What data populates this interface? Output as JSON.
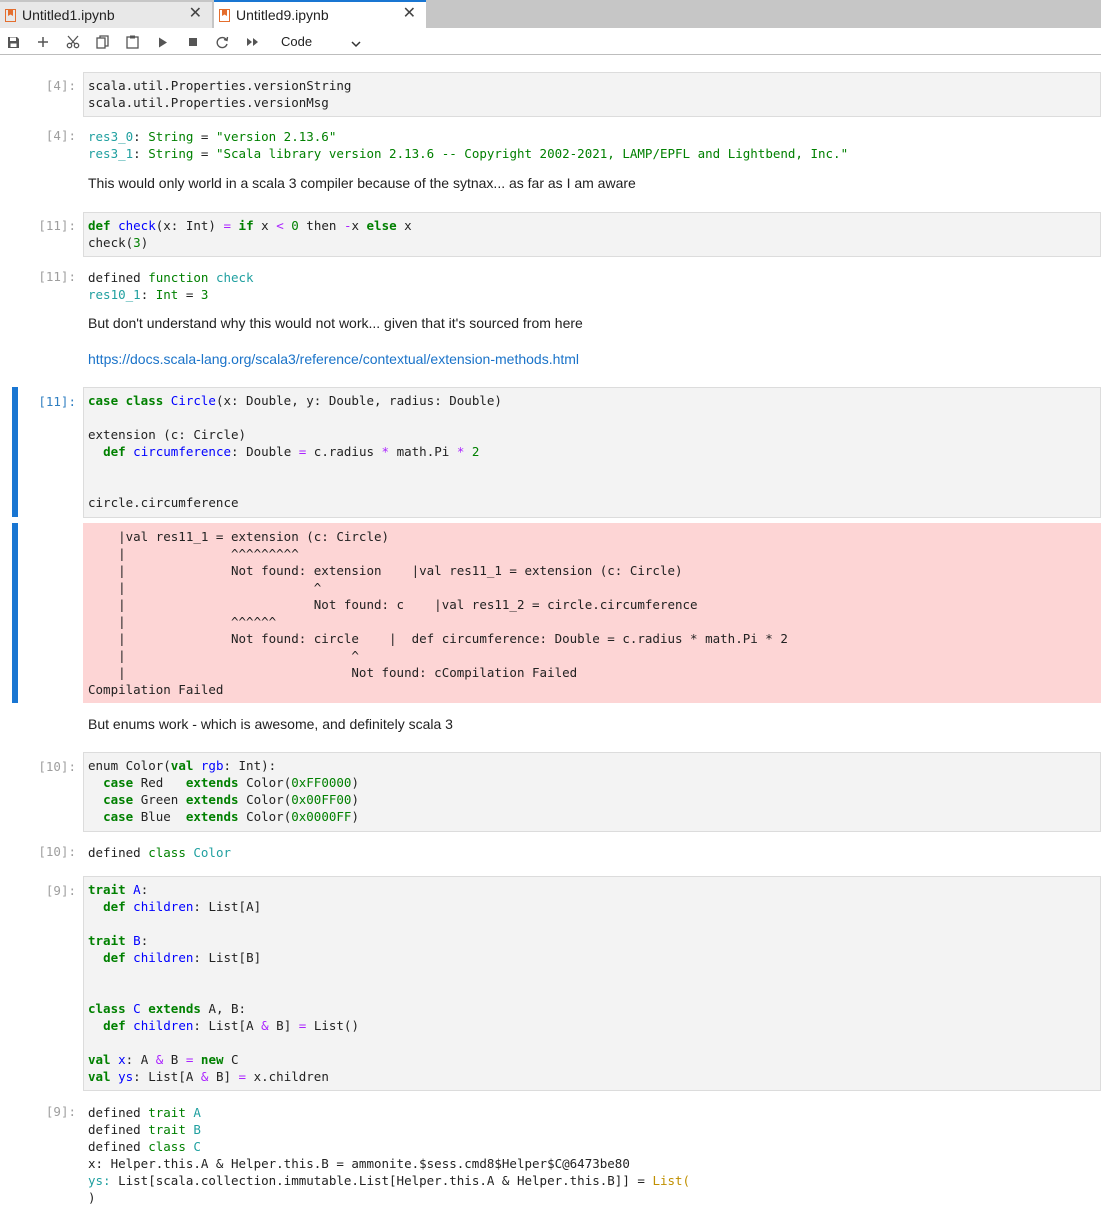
{
  "tabs": [
    {
      "label": "Untitled1.ipynb",
      "active": false
    },
    {
      "label": "Untitled9.ipynb",
      "active": true
    }
  ],
  "toolbar": {
    "cell_type": "Code",
    "icons": [
      "save-icon",
      "add-icon",
      "cut-icon",
      "copy-icon",
      "paste-icon",
      "run-icon",
      "stop-icon",
      "restart-icon",
      "fast-forward-icon",
      "chevron-down-icon"
    ]
  },
  "cells": {
    "c1": {
      "in_prompt": "[4]:",
      "code": [
        "scala.util.Properties.versionString",
        "scala.util.Properties.versionMsg"
      ],
      "out_prompt": "[4]:",
      "out": {
        "r1_name": "res3_0",
        "r1_type": "String",
        "r1_val": "\"version 2.13.6\"",
        "r2_name": "res3_1",
        "r2_type": "String",
        "r2_val": "\"Scala library version 2.13.6 -- Copyright 2002-2021, LAMP/EPFL and Lightbend, Inc.\""
      }
    },
    "md1": "This would only world in a scala 3 compiler because of the sytnax... as far as I am aware",
    "c2": {
      "in_prompt": "[11]:",
      "out_prompt": "[11]:",
      "out_line1_a": "defined ",
      "out_line1_b": "function ",
      "out_line1_c": "check",
      "out_line2_name": "res10_1",
      "out_line2_type": "Int",
      "out_line2_val": "3"
    },
    "md2": "But don't understand why this would not work... given that it's sourced from here",
    "md3_link": "https://docs.scala-lang.org/scala3/reference/contextual/extension-methods.html",
    "c3": {
      "in_prompt": "[11]:",
      "error_lines": [
        "    |val res11_1 = extension (c: Circle)",
        "    |              ^^^^^^^^^",
        "    |              Not found: extension    |val res11_1 = extension (c: Circle)",
        "    |                         ^",
        "    |                         Not found: c    |val res11_2 = circle.circumference",
        "    |              ^^^^^^",
        "    |              Not found: circle    |  def circumference: Double = c.radius * math.Pi * 2",
        "    |                              ^",
        "    |                              Not found: cCompilation Failed",
        "Compilation Failed"
      ]
    },
    "md4": "But enums work - which is awesome, and definitely scala 3",
    "c4": {
      "in_prompt": "[10]:",
      "out_prompt": "[10]:",
      "out_a": "defined ",
      "out_b": "class ",
      "out_c": "Color"
    },
    "c5": {
      "in_prompt": "[9]:",
      "out_prompt": "[9]:",
      "out_x": "x: Helper.this.A & Helper.this.B = ammonite.$sess.cmd8$Helper$C@6473be80",
      "out_ys_a": "ys: ",
      "out_ys_b": "List[scala.collection.immutable.List[Helper.this.A & Helper.this.B]] = ",
      "out_ys_c": "List(",
      "out_close": ")"
    }
  }
}
